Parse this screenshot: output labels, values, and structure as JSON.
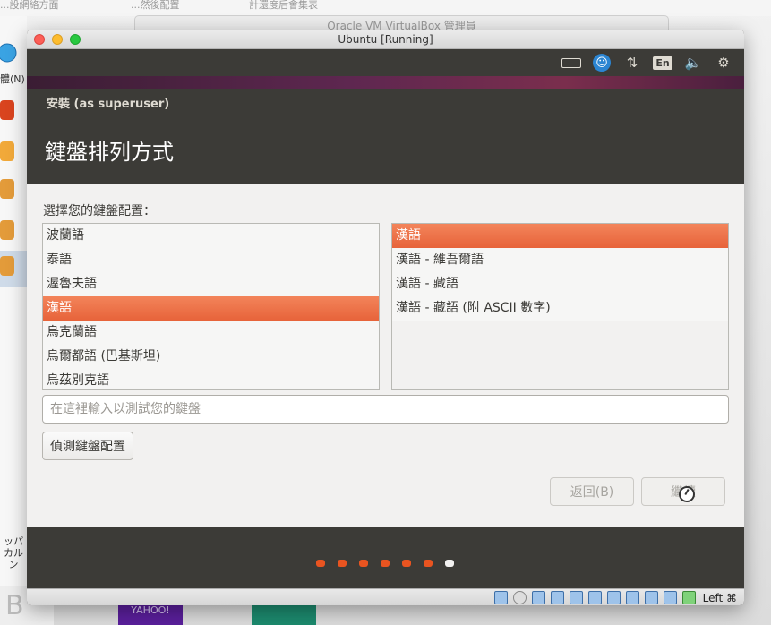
{
  "background": {
    "top_labels": [
      "...設網絡方面",
      "...然後配置",
      "計還度后會集表"
    ],
    "vbox_manager_title": "Oracle VM VirtualBox 管理員",
    "left_label": "體(N)",
    "left_jp": "ッパカル\nン",
    "left_letter": "B",
    "yahoo_text": "YAHOO!"
  },
  "window": {
    "title": "Ubuntu [Running]"
  },
  "panel": {
    "language": "En"
  },
  "installer": {
    "title": "安裝 (as superuser)",
    "heading": "鍵盤排列方式",
    "prompt": "選擇您的鍵盤配置：",
    "layouts": [
      {
        "label": "波蘭語",
        "selected": false
      },
      {
        "label": "泰語",
        "selected": false
      },
      {
        "label": "渥魯夫語",
        "selected": false
      },
      {
        "label": "漢語",
        "selected": true
      },
      {
        "label": "烏克蘭語",
        "selected": false
      },
      {
        "label": "烏爾都語 (巴基斯坦)",
        "selected": false
      },
      {
        "label": "烏茲別克語",
        "selected": false
      }
    ],
    "variants": [
      {
        "label": "漢語",
        "selected": true
      },
      {
        "label": "漢語 - 維吾爾語",
        "selected": false
      },
      {
        "label": "漢語 - 藏語",
        "selected": false
      },
      {
        "label": "漢語 - 藏語 (附 ASCII 數字)",
        "selected": false
      }
    ],
    "test_placeholder": "在這裡輸入以測試您的鍵盤",
    "detect_label": "偵測鍵盤配置",
    "back_label": "返回(B)",
    "continue_label": "繼續"
  },
  "progress": {
    "total_steps": 7,
    "current_step": 7
  },
  "statusbar": {
    "host_key": "Left ⌘"
  },
  "colors": {
    "ubuntu_orange": "#e95420",
    "panel": "#3c3b37",
    "aubergine": "#5e2750"
  }
}
